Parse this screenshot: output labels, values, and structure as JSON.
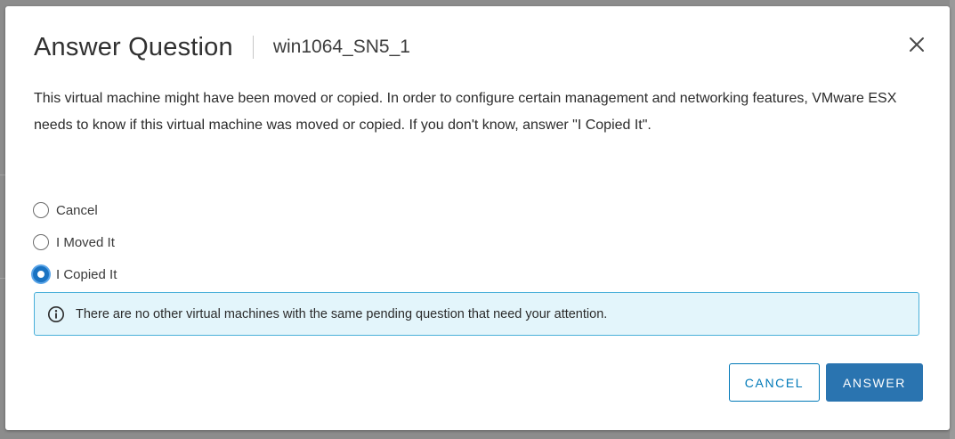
{
  "dialog": {
    "title": "Answer Question",
    "subtitle": "win1064_SN5_1",
    "message": "This virtual machine might have been moved or copied. In order to configure certain management and networking features, VMware ESX needs to know if this virtual machine was moved or copied. If you don't know, answer \"I Copied It\".",
    "options": [
      {
        "label": "Cancel",
        "selected": false
      },
      {
        "label": "I Moved It",
        "selected": false
      },
      {
        "label": "I Copied It",
        "selected": true
      }
    ],
    "info_alert": {
      "icon": "info-icon",
      "text": "There are no other virtual machines with the same pending question that need your attention."
    },
    "buttons": {
      "cancel_label": "CANCEL",
      "answer_label": "ANSWER"
    },
    "close_icon": "close-icon"
  },
  "colors": {
    "primary": "#2a74b0",
    "outline": "#0079b8",
    "info_bg": "#e3f5fb",
    "info_border": "#49afd9",
    "radio_selected": "#1a73c2"
  }
}
